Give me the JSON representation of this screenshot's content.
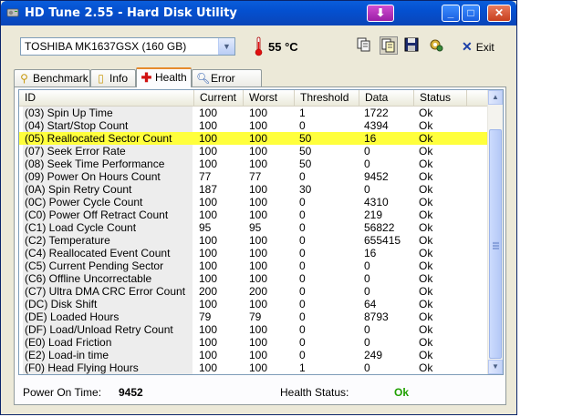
{
  "window": {
    "title": "HD Tune 2.55 - Hard Disk Utility"
  },
  "title_buttons": [
    {
      "name": "screenshot",
      "glyph": "⬇"
    },
    {
      "name": "minimize",
      "glyph": "_"
    },
    {
      "name": "maximize",
      "glyph": "□"
    },
    {
      "name": "close",
      "glyph": "✕"
    }
  ],
  "toolbar": {
    "drive": "TOSHIBA MK1637GSX (160 GB)",
    "temperature": "55 °C",
    "exit_label": "Exit"
  },
  "tabs": [
    {
      "label": "Benchmark",
      "icon": "benchmark-icon"
    },
    {
      "label": "Info",
      "icon": "info-icon"
    },
    {
      "label": "Health",
      "icon": "health-cross-icon",
      "active": true
    },
    {
      "label": "Error Scan",
      "icon": "magnifier-icon"
    }
  ],
  "table": {
    "columns": [
      "ID",
      "Current",
      "Worst",
      "Threshold",
      "Data",
      "Status"
    ],
    "rows": [
      {
        "id": "(03) Spin Up Time",
        "current": "100",
        "worst": "100",
        "threshold": "1",
        "data": "1722",
        "status": "Ok"
      },
      {
        "id": "(04) Start/Stop Count",
        "current": "100",
        "worst": "100",
        "threshold": "0",
        "data": "4394",
        "status": "Ok"
      },
      {
        "id": "(05) Reallocated Sector Count",
        "current": "100",
        "worst": "100",
        "threshold": "50",
        "data": "16",
        "status": "Ok",
        "highlight": true
      },
      {
        "id": "(07) Seek Error Rate",
        "current": "100",
        "worst": "100",
        "threshold": "50",
        "data": "0",
        "status": "Ok"
      },
      {
        "id": "(08) Seek Time Performance",
        "current": "100",
        "worst": "100",
        "threshold": "50",
        "data": "0",
        "status": "Ok"
      },
      {
        "id": "(09) Power On Hours Count",
        "current": "77",
        "worst": "77",
        "threshold": "0",
        "data": "9452",
        "status": "Ok"
      },
      {
        "id": "(0A) Spin Retry Count",
        "current": "187",
        "worst": "100",
        "threshold": "30",
        "data": "0",
        "status": "Ok"
      },
      {
        "id": "(0C) Power Cycle Count",
        "current": "100",
        "worst": "100",
        "threshold": "0",
        "data": "4310",
        "status": "Ok"
      },
      {
        "id": "(C0) Power Off Retract Count",
        "current": "100",
        "worst": "100",
        "threshold": "0",
        "data": "219",
        "status": "Ok"
      },
      {
        "id": "(C1) Load Cycle Count",
        "current": "95",
        "worst": "95",
        "threshold": "0",
        "data": "56822",
        "status": "Ok"
      },
      {
        "id": "(C2) Temperature",
        "current": "100",
        "worst": "100",
        "threshold": "0",
        "data": "655415",
        "status": "Ok"
      },
      {
        "id": "(C4) Reallocated Event Count",
        "current": "100",
        "worst": "100",
        "threshold": "0",
        "data": "16",
        "status": "Ok"
      },
      {
        "id": "(C5) Current Pending Sector",
        "current": "100",
        "worst": "100",
        "threshold": "0",
        "data": "0",
        "status": "Ok"
      },
      {
        "id": "(C6) Offline Uncorrectable",
        "current": "100",
        "worst": "100",
        "threshold": "0",
        "data": "0",
        "status": "Ok"
      },
      {
        "id": "(C7) Ultra DMA CRC Error Count",
        "current": "200",
        "worst": "200",
        "threshold": "0",
        "data": "0",
        "status": "Ok"
      },
      {
        "id": "(DC) Disk Shift",
        "current": "100",
        "worst": "100",
        "threshold": "0",
        "data": "64",
        "status": "Ok"
      },
      {
        "id": "(DE) Loaded Hours",
        "current": "79",
        "worst": "79",
        "threshold": "0",
        "data": "8793",
        "status": "Ok"
      },
      {
        "id": "(DF) Load/Unload Retry Count",
        "current": "100",
        "worst": "100",
        "threshold": "0",
        "data": "0",
        "status": "Ok"
      },
      {
        "id": "(E0) Load Friction",
        "current": "100",
        "worst": "100",
        "threshold": "0",
        "data": "0",
        "status": "Ok"
      },
      {
        "id": "(E2) Load-in time",
        "current": "100",
        "worst": "100",
        "threshold": "0",
        "data": "249",
        "status": "Ok"
      },
      {
        "id": "(F0) Head Flying Hours",
        "current": "100",
        "worst": "100",
        "threshold": "1",
        "data": "0",
        "status": "Ok"
      }
    ]
  },
  "footer": {
    "power_on_label": "Power On Time:",
    "power_on_value": "9452",
    "health_label": "Health Status:",
    "health_value": "Ok"
  },
  "colors": {
    "highlight": "#ffff3c",
    "health_ok": "#1fa000",
    "temperature": "#000000"
  }
}
